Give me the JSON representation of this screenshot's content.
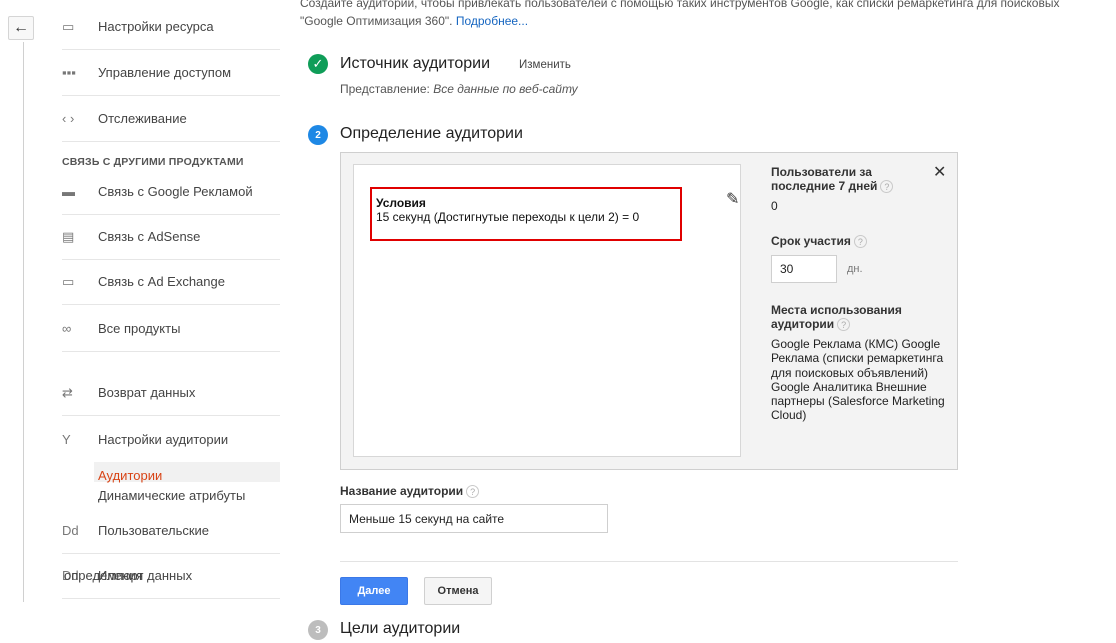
{
  "nav": {
    "back_icon": "←",
    "items": [
      {
        "icon": "▭",
        "label": "Настройки ресурса"
      },
      {
        "icon": "▪▪▪",
        "label": "Управление доступом"
      },
      {
        "icon": "‹ ›",
        "label": "Отслеживание"
      },
      {
        "icon": "▬",
        "label": "Связь с Google Рекламой"
      },
      {
        "icon": "▤",
        "label": "Связь с AdSense"
      },
      {
        "icon": "▭",
        "label": "Связь с Ad Exchange"
      },
      {
        "icon": "∞",
        "label": "Все продукты"
      },
      {
        "icon": "⇄",
        "label": "Возврат данных"
      },
      {
        "icon": "Y",
        "label": "Настройки аудитории"
      },
      {
        "icon": "Dd",
        "label": "Пользовательские"
      },
      {
        "icon": "Dd",
        "label": "Импорт данных"
      }
    ],
    "section_heading": "СВЯЗЬ С ДРУГИМИ ПРОДУКТАМИ",
    "sub_items": [
      "Аудитории",
      "Динамические атрибуты"
    ],
    "overlap_text": "определения"
  },
  "intro": {
    "text": "Создайте аудитории, чтобы привлекать пользователей с помощью таких инструментов Google, как списки ремаркетинга для поисковых",
    "text2": "\"Google Оптимизация 360\".",
    "link": "Подробнее..."
  },
  "step1": {
    "title": "Источник аудитории",
    "change": "Изменить",
    "view_label": "Представление:",
    "view_value": "Все данные по веб-сайту"
  },
  "step2": {
    "number": "2",
    "title": "Определение аудитории",
    "condition_title": "Условия",
    "condition_text": "15 секунд (Достигнутые переходы к цели 2) = 0",
    "users_label": "Пользователи за последние 7 дней",
    "users_value": "0",
    "duration_label": "Срок участия",
    "duration_value": "30",
    "duration_unit": "дн.",
    "uses_label": "Места использования аудитории",
    "uses_list": "Google Реклама (КМС) Google Реклама (списки ремаркетинга для поисковых объявлений) Google Аналитика Внешние партнеры (Salesforce Marketing Cloud)",
    "help": "?"
  },
  "name": {
    "label": "Название аудитории",
    "value": "Меньше 15 секунд на сайте"
  },
  "buttons": {
    "next": "Далее",
    "cancel": "Отмена"
  },
  "step3": {
    "number": "3",
    "title": "Цели аудитории"
  },
  "colors": {
    "accent": "#4285f4",
    "success": "#0f9d58",
    "active": "#d84315",
    "highlight": "#e00000"
  }
}
